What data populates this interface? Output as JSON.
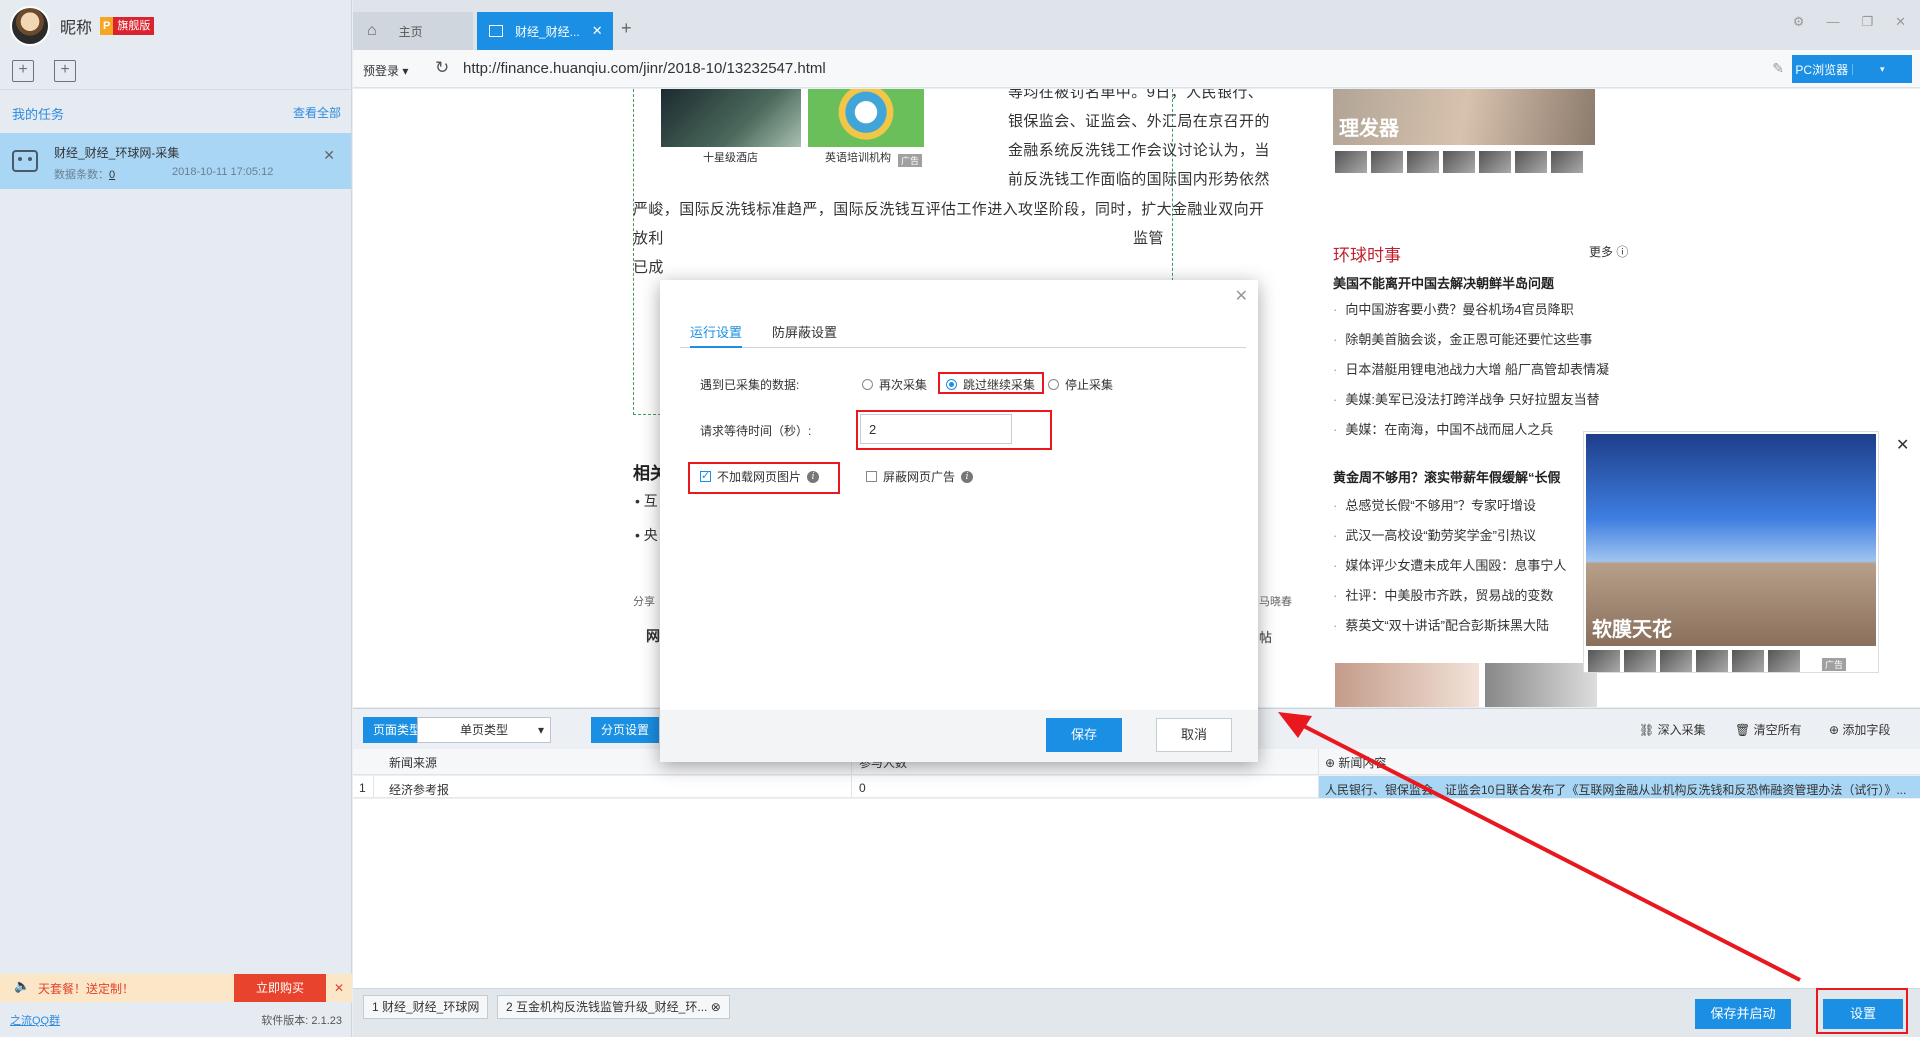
{
  "sidebar": {
    "nickname": "昵称",
    "vip_p": "P",
    "vip_label": "旗舰版",
    "mytask_label": "我的任务",
    "view_all": "查看全部",
    "task": {
      "name": "财经_财经_环球网-采集",
      "count_label": "数据条数：",
      "count_value": "0",
      "date": "2018-10-11 17:05:12"
    },
    "promo_text": "天套餐！送定制！",
    "buy_label": "立即购买",
    "qq_group": "之流QQ群",
    "version": "软件版本: 2.1.23"
  },
  "browser": {
    "home_tab": "主页",
    "active_tab": "财经_财经...",
    "login_dropdown": "预登录",
    "url": "http://finance.huanqiu.com/jinr/2018-10/13232547.html",
    "pc_browser": "PC浏览器"
  },
  "webpage": {
    "caption1": "十星级酒店",
    "caption2": "英语培训机构",
    "ad_label": "广告",
    "article_lines": [
      "等均在被罚名单中。9日，人民银行、",
      "银保监会、证监会、外汇局在京召开的",
      "金融系统反洗钱工作会议讨论认为，当",
      "前反洗钱工作面临的国际国内形势依然",
      "严峻，国际反洗钱标准趋严，国际反洗钱互评估工作进入攻坚阶段，同时，扩大金融业双向开",
      "放利",
      "已成"
    ],
    "article_tail": "监管",
    "related_title": "相关",
    "bullet1": "互",
    "bullet2": "央",
    "share_label": "分享",
    "share_right": "马晓春",
    "post_right": "帖",
    "bottom_left_char": "网",
    "ad_top_label": "理发器",
    "news_title": "环球时事",
    "more_label": "更多",
    "news_head1": "美国不能离开中国去解决朝鲜半岛问题",
    "news_items1": [
      "向中国游客要小费？曼谷机场4官员降职",
      "除朝美首脑会谈，金正恩可能还要忙这些事",
      "日本潜艇用锂电池战力大增 船厂高管却表情凝",
      "美媒:美军已没法打跨洋战争 只好拉盟友当替",
      "美媒：在南海，中国不战而屈人之兵"
    ],
    "news_head2": "黄金周不够用？滚实带薪年假缓解“长假",
    "news_items2": [
      "总感觉长假“不够用”？专家吁增设",
      "武汉一高校设“勤劳奖学金”引热议",
      "媒体评少女遭未成年人围殴：息事宁人",
      "社评：中美股市齐跌，贸易战的变数",
      "蔡英文“双十讲话”配合彭斯抹黑大陆"
    ],
    "float_ad_label": "软膜天花"
  },
  "panel": {
    "page_type_btn": "页面类型",
    "page_type_value": "单页类型",
    "pagination_btn": "分页设置",
    "deep_collect": "深入采集",
    "clear_all": "清空所有",
    "add_field": "添加字段",
    "col1": "新闻来源",
    "col2": "参与人数",
    "col3": "新闻内容",
    "row_index": "1",
    "row_source": "经济参考报",
    "row_count": "0",
    "row_content": "人民银行、银保监会、证监会10日联合发布了《互联网金融从业机构反洗钱和反恐怖融资管理办法（试行）》..."
  },
  "statusbar": {
    "tab1": "1 财经_财经_环球网",
    "tab2": "2 互金机构反洗钱监管升级_财经_环...",
    "save_start": "保存并启动",
    "settings": "设置"
  },
  "modal": {
    "tab_run": "运行设置",
    "tab_block": "防屏蔽设置",
    "collected_label": "遇到已采集的数据:",
    "opt_recollect": "再次采集",
    "opt_skip": "跳过继续采集",
    "opt_stop": "停止采集",
    "wait_label": "请求等待时间（秒）:",
    "wait_value": "2",
    "no_images": "不加载网页图片",
    "block_ads": "屏蔽网页广告",
    "save": "保存",
    "cancel": "取消"
  },
  "colors": {
    "accent": "#1a8fe3",
    "highlight_red": "#e8181e"
  }
}
